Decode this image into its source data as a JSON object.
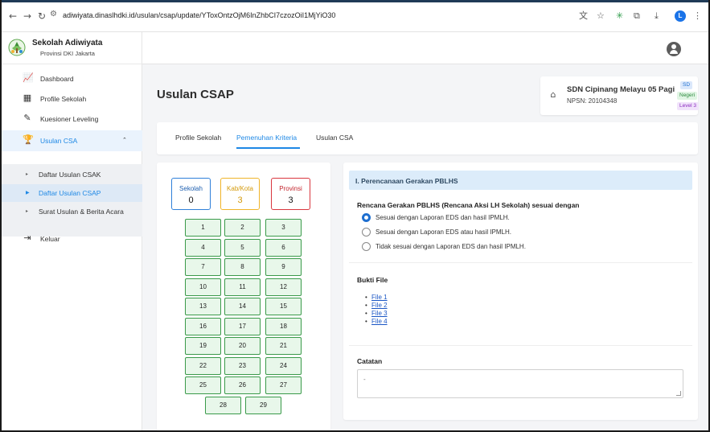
{
  "browser": {
    "url": "adiwiyata.dinaslhdki.id/usulan/csap/update/YToxOntzOjM6InZhbCI7czozOiI1MjYiO30",
    "back_icon": "arrow-left-icon",
    "forward_icon": "arrow-right-icon",
    "reload_icon": "reload-icon",
    "profile_initial": "L"
  },
  "brand": {
    "title": "Sekolah Adiwiyata",
    "subtitle": "Provinsi DKI Jakarta"
  },
  "sidebar": {
    "items": [
      {
        "label": "Dashboard",
        "icon": "chart-icon"
      },
      {
        "label": "Profile Sekolah",
        "icon": "building-icon"
      },
      {
        "label": "Kuesioner Leveling",
        "icon": "edit-icon"
      },
      {
        "label": "Usulan CSA",
        "icon": "trophy-icon"
      },
      {
        "label": "Keluar",
        "icon": "logout-icon"
      }
    ],
    "submenu": [
      {
        "label": "Daftar Usulan CSAK"
      },
      {
        "label": "Daftar Usulan CSAP"
      },
      {
        "label": "Surat Usulan & Berita Acara"
      }
    ]
  },
  "page": {
    "title": "Usulan CSAP"
  },
  "school": {
    "name": "SDN Cipinang Melayu 05 Pagi",
    "npsn": "NPSN: 20104348",
    "badges": {
      "level_type": "SD",
      "status": "Negeri",
      "level": "Level 3"
    }
  },
  "tabs": [
    {
      "label": "Profile Sekolah"
    },
    {
      "label": "Pemenuhan Kriteria"
    },
    {
      "label": "Usulan CSA"
    }
  ],
  "stats": {
    "sekolah": {
      "label": "Sekolah",
      "value": "0"
    },
    "kabkota": {
      "label": "Kab/Kota",
      "value": "3"
    },
    "provinsi": {
      "label": "Provinsi",
      "value": "3"
    }
  },
  "criteria_numbers": [
    "1",
    "2",
    "3",
    "4",
    "5",
    "6",
    "7",
    "8",
    "9",
    "10",
    "11",
    "12",
    "13",
    "14",
    "15",
    "16",
    "17",
    "18",
    "19",
    "20",
    "21",
    "22",
    "23",
    "24",
    "25",
    "26",
    "27",
    "28",
    "29"
  ],
  "detail": {
    "section_title": "I. Perencanaan Gerakan PBLHS",
    "question": "Rencana Gerakan PBLHS (Rencana Aksi LH Sekolah) sesuai dengan",
    "options": [
      "Sesuai dengan Laporan EDS dan hasil IPMLH.",
      "Sesuai dengan Laporan EDS atau hasil IPMLH.",
      "Tidak sesuai dengan Laporan EDS dan hasil IPMLH."
    ],
    "selected_option": 0,
    "bukti_title": "Bukti File",
    "files": [
      "File 1",
      "File 2",
      "File 3",
      "File 4"
    ],
    "catatan_title": "Catatan",
    "catatan_value": "-"
  },
  "colors": {
    "accent": "#1e88e5",
    "active_bg": "#eaf3fd",
    "number_bg": "#e8f7ea",
    "number_border": "#3a9a4a"
  }
}
